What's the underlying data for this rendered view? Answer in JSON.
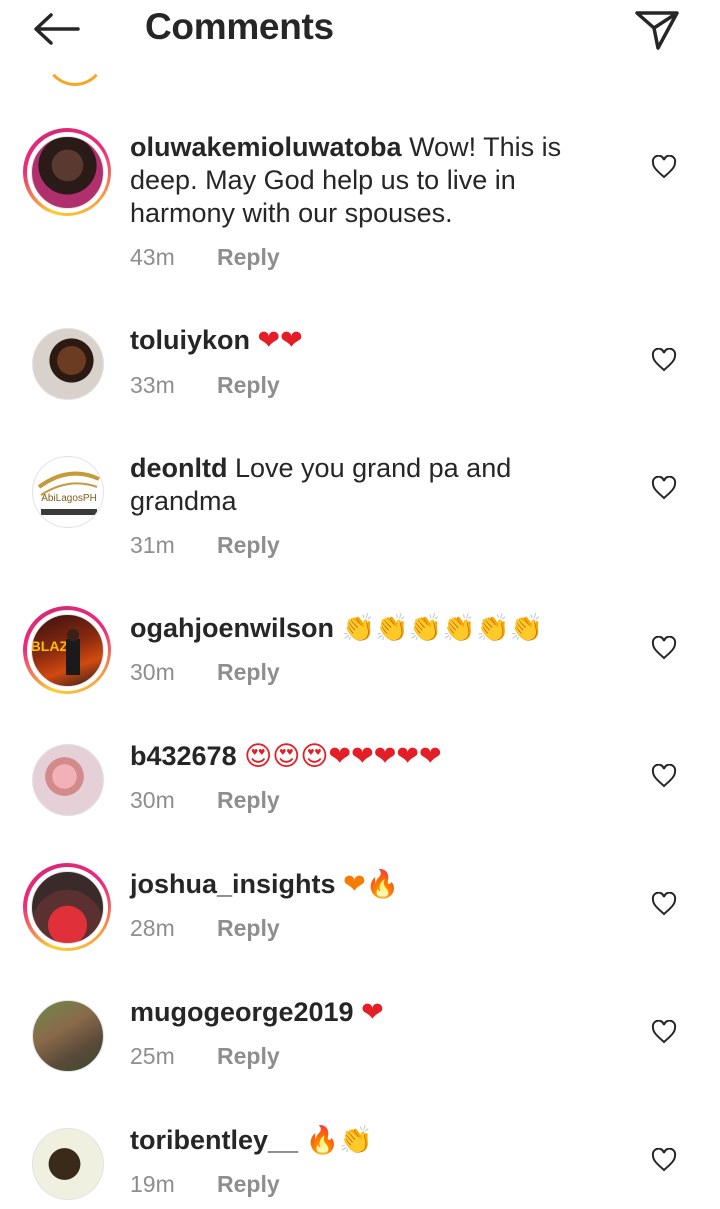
{
  "header": {
    "title": "Comments",
    "back_icon": "arrow-left-icon",
    "send_icon": "paper-plane-icon"
  },
  "reply_label": "Reply",
  "colors": {
    "text": "#262626",
    "muted": "#8e8e8e",
    "heart": "#e41e26",
    "story_ring_start": "#f9ce34",
    "story_ring_end": "#ee2a7b"
  },
  "comments": [
    {
      "username": "oluwakemioluwatoba",
      "text": "Wow! This is deep. May God help us to live in harmony with our spouses.",
      "time": "43m",
      "story_ring": true
    },
    {
      "username": "toluiykon",
      "text": "",
      "emojis": "❤❤",
      "time": "33m",
      "story_ring": false
    },
    {
      "username": "deonltd",
      "text": "Love you grand pa and grandma",
      "time": "31m",
      "story_ring": false,
      "avatar_text": "AbiLagosPH"
    },
    {
      "username": "ogahjoenwilson",
      "text": "",
      "emojis": "👏👏👏👏👏👏",
      "time": "30m",
      "story_ring": true,
      "avatar_text": "BLAZE"
    },
    {
      "username": "b432678",
      "text": "",
      "emojis": "😍😍😍❤❤❤❤❤",
      "time": "30m",
      "story_ring": false
    },
    {
      "username": "joshua_insights",
      "text": "",
      "emojis": "❤🔥",
      "time": "28m",
      "story_ring": true
    },
    {
      "username": "mugogeorge2019",
      "text": "",
      "emojis": "❤",
      "time": "25m",
      "story_ring": false
    },
    {
      "username": "toribentley__",
      "text": "",
      "emojis": "🔥👏",
      "time": "19m",
      "story_ring": false
    }
  ]
}
